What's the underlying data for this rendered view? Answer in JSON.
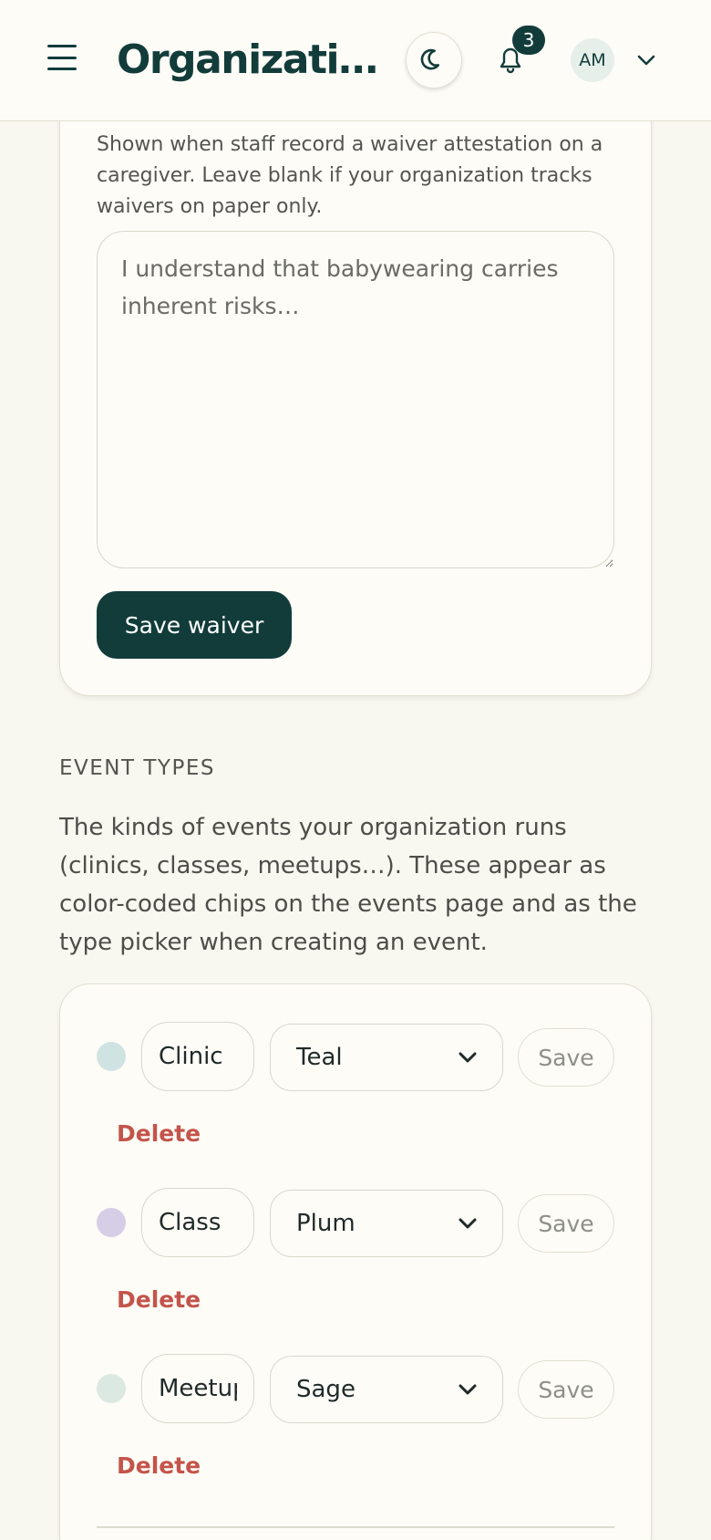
{
  "header": {
    "title": "Organizations",
    "notification_count": "3",
    "avatar_initials": "AM",
    "icons": [
      "hamburger-menu-icon",
      "moon-icon",
      "bell-icon",
      "chevron-down-icon"
    ]
  },
  "waiver": {
    "help_text": "Shown when staff record a waiver attestation on a caregiver. Leave blank if your organization tracks waivers on paper only.",
    "placeholder": "I understand that babywearing carries inherent risks…",
    "value": "",
    "save_label": "Save waiver"
  },
  "event_types": {
    "heading": "EVENT TYPES",
    "description": "The kinds of events your organization runs (clinics, classes, meetups…). These appear as color-coded chips on the events page and as the type picker when creating an event.",
    "rows": [
      {
        "name": "Clinic",
        "color_label": "Teal",
        "dot_color": "#cfe3e2",
        "save_label": "Save",
        "delete_label": "Delete"
      },
      {
        "name": "Class",
        "color_label": "Plum",
        "dot_color": "#d6cde6",
        "save_label": "Save",
        "delete_label": "Delete"
      },
      {
        "name": "Meetup",
        "color_label": "Sage",
        "dot_color": "#dbe9e2",
        "save_label": "Save",
        "delete_label": "Delete"
      }
    ]
  },
  "colors": {
    "brand": "#123c3a",
    "danger": "#c4544a",
    "background": "#f8f7f0",
    "card": "#fdfcf7"
  }
}
